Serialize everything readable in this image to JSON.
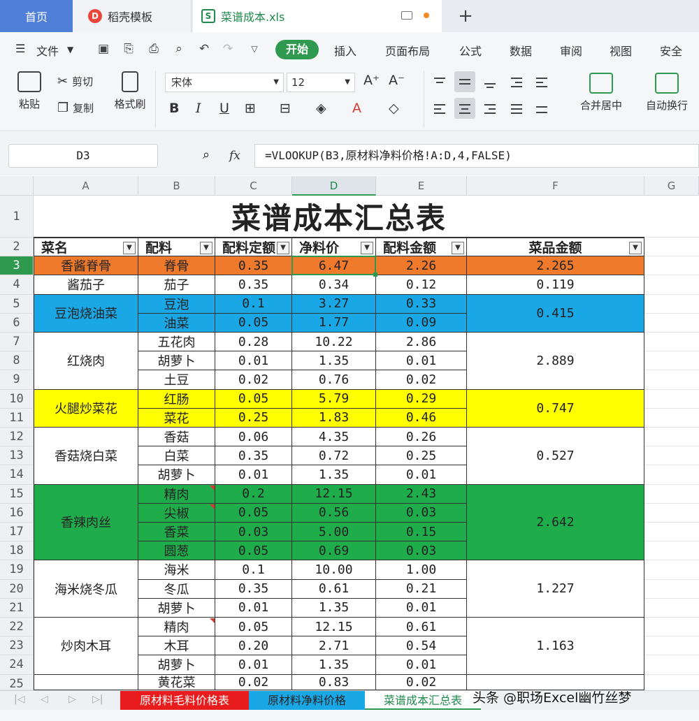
{
  "tabs": {
    "home": "首页",
    "daoke": "稻壳模板",
    "doc": "菜谱成本.xls",
    "new": "+"
  },
  "menu": {
    "file": "文件",
    "items": [
      "开始",
      "插入",
      "页面布局",
      "公式",
      "数据",
      "审阅",
      "视图",
      "安全"
    ]
  },
  "ribbon": {
    "paste": "粘贴",
    "cut": "剪切",
    "copy": "复制",
    "format_painter": "格式刷",
    "font_name": "宋体",
    "font_size": "12",
    "merge_center": "合并居中",
    "wrap_text": "自动换行"
  },
  "formula_bar": {
    "name_box": "D3",
    "fx": "fx",
    "formula": "=VLOOKUP(B3,原材料净料价格!A:D,4,FALSE)"
  },
  "columns": [
    "A",
    "B",
    "C",
    "D",
    "E",
    "F",
    "G"
  ],
  "rows": [
    "1",
    "2",
    "3",
    "4",
    "5",
    "6",
    "7",
    "8",
    "9",
    "10",
    "11",
    "12",
    "13",
    "14",
    "15",
    "16",
    "17",
    "18",
    "19",
    "20",
    "21",
    "22",
    "23",
    "24",
    "25"
  ],
  "sheet": {
    "title": "菜谱成本汇总表",
    "headers": [
      "菜名",
      "配料",
      "配料定额",
      "净料价",
      "配料金额",
      "菜品金额"
    ],
    "dishes": [
      {
        "name": "香酱脊骨",
        "total": "2.265",
        "color": "#f07a2c",
        "items": [
          {
            "ing": "脊骨",
            "qty": "0.35",
            "price": "6.47",
            "amt": "2.26"
          }
        ]
      },
      {
        "name": "酱茄子",
        "total": "0.119",
        "color": "#ffffff",
        "items": [
          {
            "ing": "茄子",
            "qty": "0.35",
            "price": "0.34",
            "amt": "0.12"
          }
        ]
      },
      {
        "name": "豆泡烧油菜",
        "total": "0.415",
        "color": "#1aa7e6",
        "items": [
          {
            "ing": "豆泡",
            "qty": "0.1",
            "price": "3.27",
            "amt": "0.33"
          },
          {
            "ing": "油菜",
            "qty": "0.05",
            "price": "1.77",
            "amt": "0.09"
          }
        ]
      },
      {
        "name": "红烧肉",
        "total": "2.889",
        "color": "#ffffff",
        "items": [
          {
            "ing": "五花肉",
            "qty": "0.28",
            "price": "10.22",
            "amt": "2.86"
          },
          {
            "ing": "胡萝卜",
            "qty": "0.01",
            "price": "1.35",
            "amt": "0.01"
          },
          {
            "ing": "土豆",
            "qty": "0.02",
            "price": "0.76",
            "amt": "0.02"
          }
        ]
      },
      {
        "name": "火腿炒菜花",
        "total": "0.747",
        "color": "#ffff00",
        "items": [
          {
            "ing": "红肠",
            "qty": "0.05",
            "price": "5.79",
            "amt": "0.29"
          },
          {
            "ing": "菜花",
            "qty": "0.25",
            "price": "1.83",
            "amt": "0.46"
          }
        ]
      },
      {
        "name": "香菇烧白菜",
        "total": "0.527",
        "color": "#ffffff",
        "items": [
          {
            "ing": "香菇",
            "qty": "0.06",
            "price": "4.35",
            "amt": "0.26"
          },
          {
            "ing": "白菜",
            "qty": "0.35",
            "price": "0.72",
            "amt": "0.25"
          },
          {
            "ing": "胡萝卜",
            "qty": "0.01",
            "price": "1.35",
            "amt": "0.01"
          }
        ]
      },
      {
        "name": "香辣肉丝",
        "total": "2.642",
        "color": "#1fad4c",
        "items": [
          {
            "ing": "精肉",
            "qty": "0.2",
            "price": "12.15",
            "amt": "2.43"
          },
          {
            "ing": "尖椒",
            "qty": "0.05",
            "price": "0.56",
            "amt": "0.03"
          },
          {
            "ing": "香菜",
            "qty": "0.03",
            "price": "5.00",
            "amt": "0.15"
          },
          {
            "ing": "圆葱",
            "qty": "0.05",
            "price": "0.69",
            "amt": "0.03"
          }
        ]
      },
      {
        "name": "海米烧冬瓜",
        "total": "1.227",
        "color": "#ffffff",
        "items": [
          {
            "ing": "海米",
            "qty": "0.1",
            "price": "10.00",
            "amt": "1.00"
          },
          {
            "ing": "冬瓜",
            "qty": "0.35",
            "price": "0.61",
            "amt": "0.21"
          },
          {
            "ing": "胡萝卜",
            "qty": "0.01",
            "price": "1.35",
            "amt": "0.01"
          }
        ]
      },
      {
        "name": "炒肉木耳",
        "total": "1.163",
        "color": "#ffffff",
        "items": [
          {
            "ing": "精肉",
            "qty": "0.05",
            "price": "12.15",
            "amt": "0.61"
          },
          {
            "ing": "木耳",
            "qty": "0.20",
            "price": "2.71",
            "amt": "0.54"
          },
          {
            "ing": "胡萝卜",
            "qty": "0.01",
            "price": "1.35",
            "amt": "0.01"
          }
        ]
      },
      {
        "name": "",
        "total": "",
        "color": "#ffffff",
        "items": [
          {
            "ing": "黄花菜",
            "qty": "0.02",
            "price": "0.83",
            "amt": "0.02"
          }
        ]
      }
    ]
  },
  "sheet_tabs": [
    {
      "label": "原材料毛料价格表",
      "bg": "#e81c1c",
      "fg": "#ffffff"
    },
    {
      "label": "原材料净料价格",
      "bg": "#1aa7e6",
      "fg": "#222222"
    },
    {
      "label": "菜谱成本汇总表",
      "bg": "#ffffff",
      "fg": "#1f8a4c"
    }
  ],
  "watermark": "头条 @职场Excel幽竹丝梦",
  "colors": {
    "accent": "#2f9a4f",
    "home_tab": "#4f7fd6"
  }
}
